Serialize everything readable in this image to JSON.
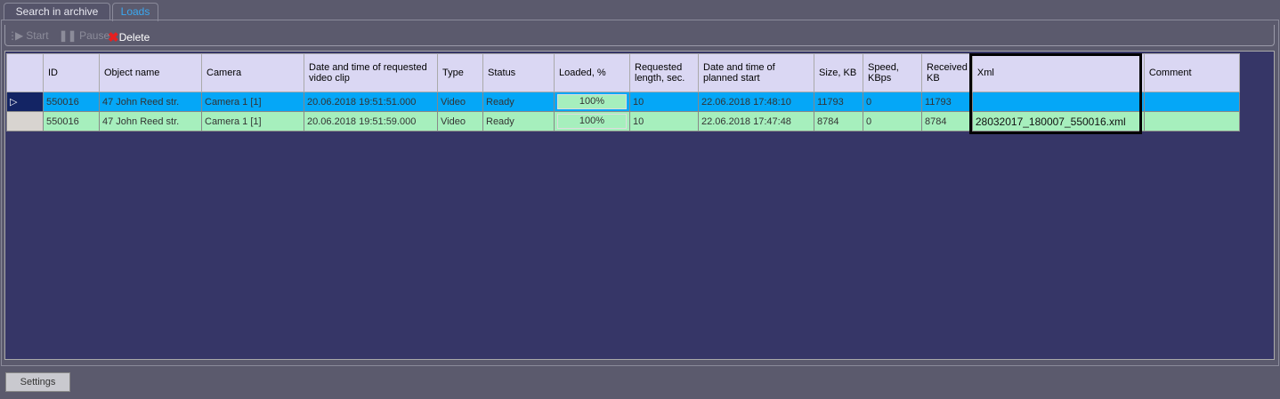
{
  "tabs": [
    {
      "label": "Search in archive",
      "active": false
    },
    {
      "label": "Loads",
      "active": true
    }
  ],
  "toolbar": {
    "start": "Start",
    "pause": "Pause",
    "delete": "Delete"
  },
  "table": {
    "columns": [
      "",
      "ID",
      "Object name",
      "Camera",
      "Date and time of requested video clip",
      "Type",
      "Status",
      "Loaded, %",
      "Requested length, sec.",
      "Date and time of planned start",
      "Size, KB",
      "Speed, KBps",
      "Received KB",
      "Xml",
      "Comment"
    ],
    "rows": [
      {
        "selected": true,
        "cells": [
          "",
          "550016",
          "47 John Reed str.",
          "Camera 1 [1]",
          "20.06.2018 19:51:51.000",
          "Video",
          "Ready",
          "100%",
          "10",
          "22.06.2018 17:48:10",
          "11793",
          "0",
          "11793",
          "",
          ""
        ],
        "loaded_percent": 100
      },
      {
        "selected": false,
        "cells": [
          "",
          "550016",
          "47 John Reed str.",
          "Camera 1 [1]",
          "20.06.2018 19:51:59.000",
          "Video",
          "Ready",
          "100%",
          "10",
          "22.06.2018 17:47:48",
          "8784",
          "0",
          "8784",
          "28032017_180007_550016.xml",
          ""
        ],
        "loaded_percent": 100
      }
    ]
  },
  "settings_label": "Settings",
  "colors": {
    "selected_row": "#05a7f7",
    "row": "#a6efbd",
    "header": "#dad7f3",
    "grid_bg": "#363667",
    "highlight_box": "#000000"
  }
}
